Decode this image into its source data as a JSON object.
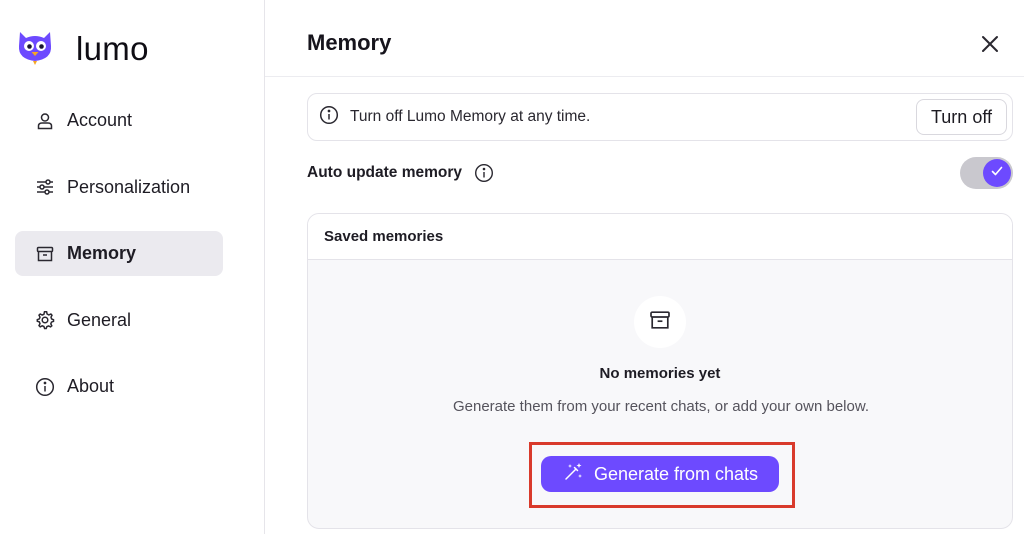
{
  "brand": {
    "name": "lumo"
  },
  "sidebar": {
    "items": [
      {
        "label": "Account",
        "icon": "user-icon",
        "active": false
      },
      {
        "label": "Personalization",
        "icon": "sliders-icon",
        "active": false
      },
      {
        "label": "Memory",
        "icon": "archive-icon",
        "active": true
      },
      {
        "label": "General",
        "icon": "gear-icon",
        "active": false
      },
      {
        "label": "About",
        "icon": "info-icon",
        "active": false
      }
    ]
  },
  "header": {
    "title": "Memory",
    "close_icon": "close-icon"
  },
  "notice": {
    "text": "Turn off Lumo Memory at any time.",
    "button_label": "Turn off",
    "icon": "info-icon"
  },
  "auto_update": {
    "label": "Auto update memory",
    "enabled": true,
    "icon": "info-icon"
  },
  "saved": {
    "title": "Saved memories",
    "empty_title": "No memories yet",
    "empty_description": "Generate them from your recent chats, or add your own below.",
    "generate_button_label": "Generate from chats",
    "empty_icon": "archive-icon",
    "generate_icon": "magic-wand-icon"
  },
  "colors": {
    "accent": "#6d4aff",
    "highlight": "#d93a2b",
    "active_nav_bg": "#ebeaef"
  }
}
